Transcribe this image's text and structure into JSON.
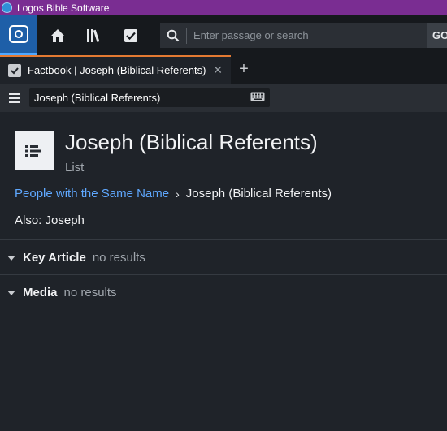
{
  "window": {
    "title": "Logos Bible Software"
  },
  "search": {
    "placeholder": "Enter passage or search",
    "go_label": "GO"
  },
  "tab": {
    "label": "Factbook | Joseph (Biblical Referents)",
    "close_glyph": "✕",
    "add_glyph": "+"
  },
  "toolbar": {
    "reference": "Joseph (Biblical Referents)"
  },
  "entry": {
    "title": "Joseph (Biblical Referents)",
    "type": "List",
    "breadcrumb": {
      "parent": "People with the Same Name",
      "separator": "›",
      "current": "Joseph (Biblical Referents)"
    },
    "also": "Also: Joseph"
  },
  "sections": [
    {
      "title": "Key Article",
      "status": "no results"
    },
    {
      "title": "Media",
      "status": "no results"
    }
  ],
  "icons": [
    "logos-logo-icon",
    "home-icon",
    "library-icon",
    "checklist-icon",
    "search-icon",
    "factbook-icon",
    "menu-icon",
    "keyboard-icon",
    "list-icon",
    "caret-down-icon"
  ],
  "colors": {
    "titlebar": "#7a2d92",
    "accent_tab": "#e47a32",
    "link": "#5fa8ff",
    "logo": "#1e5fa8"
  }
}
